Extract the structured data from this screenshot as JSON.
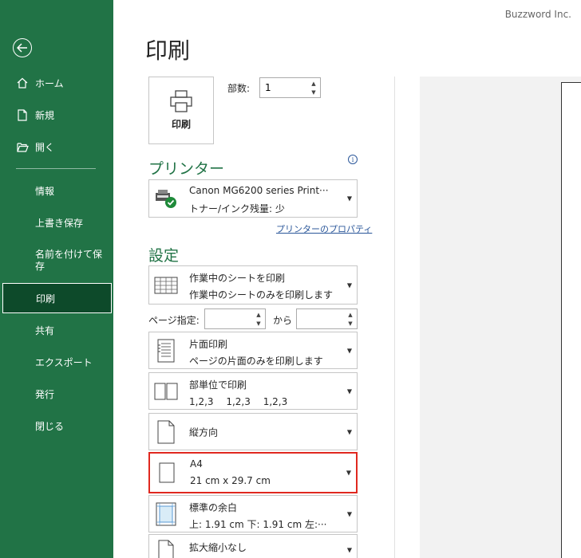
{
  "watermark": "Buzzword Inc.",
  "sidebar": {
    "back_label": "",
    "items": [
      {
        "label": "ホーム"
      },
      {
        "label": "新規"
      },
      {
        "label": "開く"
      },
      {
        "label": "情報"
      },
      {
        "label": "上書き保存"
      },
      {
        "label": "名前を付けて保存"
      },
      {
        "label": "印刷"
      },
      {
        "label": "共有"
      },
      {
        "label": "エクスポート"
      },
      {
        "label": "発行"
      },
      {
        "label": "閉じる"
      }
    ]
  },
  "main": {
    "title": "印刷",
    "print_button": "印刷",
    "copies_label": "部数:",
    "copies_value": "1",
    "printer_section": "プリンター",
    "printer": {
      "name": "Canon MG6200 series Print···",
      "status": "トナー/インク残量: 少"
    },
    "printer_properties": "プリンターのプロパティ",
    "settings_section": "設定",
    "settings": [
      {
        "l1": "作業中のシートを印刷",
        "l2": "作業中のシートのみを印刷します"
      },
      {
        "l1": "片面印刷",
        "l2": "ページの片面のみを印刷します"
      },
      {
        "l1": "部単位で印刷",
        "l2": "1,2,3　 1,2,3　 1,2,3"
      },
      {
        "l1": "縦方向"
      },
      {
        "l1": "A4",
        "l2": "21 cm x 29.7 cm"
      },
      {
        "l1": "標準の余白",
        "l2": "上: 1.91 cm 下: 1.91 cm 左:···"
      },
      {
        "l1": "拡大縮小なし"
      }
    ],
    "pages_label": "ページ指定:",
    "pages_from": "",
    "pages_to_label": "から",
    "pages_to": ""
  },
  "colors": {
    "sidebar": "#217346",
    "active": "#0d4a2a",
    "accent": "#217346",
    "highlight": "#e0281f"
  }
}
